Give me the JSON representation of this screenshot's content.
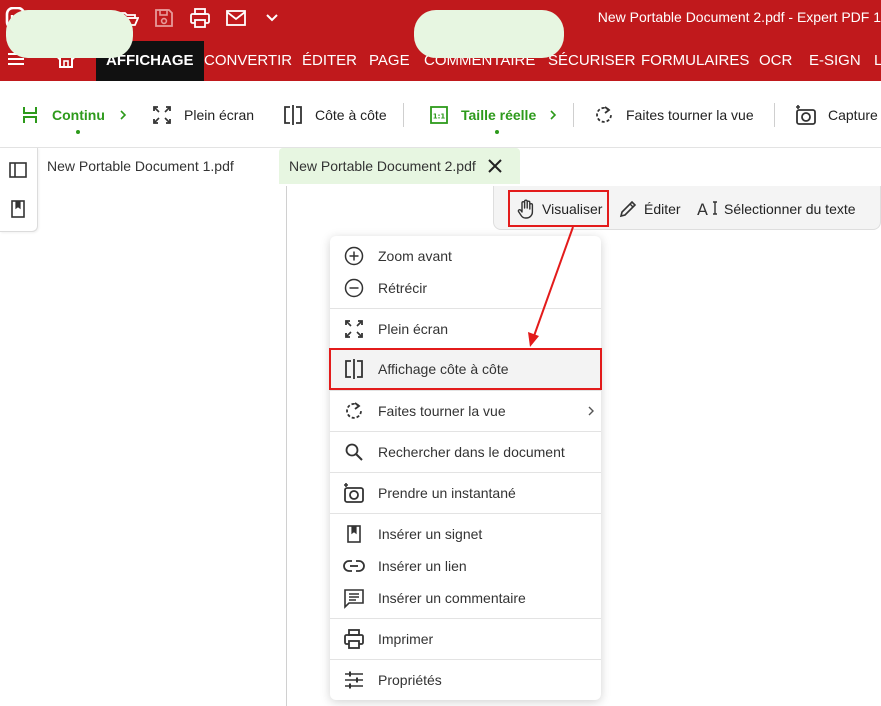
{
  "title_bar": {
    "window_title": "New Portable Document 2.pdf   -   Expert PDF 1",
    "icons": [
      "app-logo-icon",
      "undo-icon",
      "redo-icon",
      "open-folder-icon",
      "save-icon",
      "print-icon",
      "email-icon",
      "chevron-down-icon"
    ]
  },
  "menu": {
    "tabs": [
      "AFFICHAGE",
      "CONVERTIR",
      "ÉDITER",
      "PAGE",
      "COMMENTAIRE",
      "SÉCURISER",
      "FORMULAIRES",
      "OCR",
      "E-SIGN",
      "L"
    ],
    "active_tab": "AFFICHAGE"
  },
  "ribbon": {
    "continuous": "Continu",
    "fullscreen": "Plein écran",
    "side_by_side": "Côte à côte",
    "actual_size": "Taille réelle",
    "rotate_view": "Faites tourner la vue",
    "capture": "Capture"
  },
  "tabs": {
    "doc1": "New Portable Document 1.pdf",
    "doc2": "New Portable Document 2.pdf"
  },
  "mode_bar": {
    "view": "Visualiser",
    "edit": "Éditer",
    "select_text": "Sélectionner du texte"
  },
  "context_menu": {
    "zoom_in": "Zoom avant",
    "zoom_out": "Rétrécir",
    "fullscreen": "Plein écran",
    "side_by_side": "Affichage côte à côte",
    "rotate_view": "Faites tourner la vue",
    "search_document": "Rechercher dans le document",
    "snapshot": "Prendre un instantané",
    "insert_bookmark": "Insérer un signet",
    "insert_link": "Insérer un lien",
    "insert_comment": "Insérer un commentaire",
    "print": "Imprimer",
    "properties": "Propriétés"
  },
  "colors": {
    "brand_red": "#c0191c",
    "accent_green": "#2d9a1b",
    "pill_green": "#e7f6e1",
    "annotation_red": "#e31b1b"
  }
}
